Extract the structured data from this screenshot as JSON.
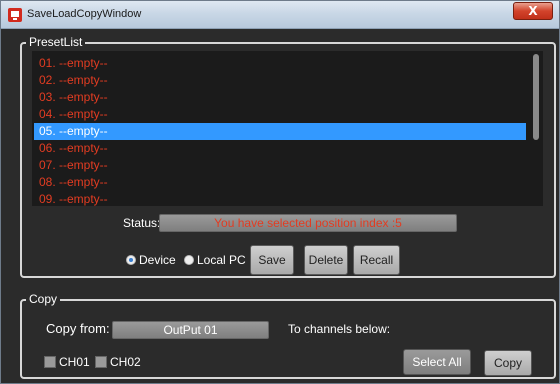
{
  "window": {
    "title": "SaveLoadCopyWindow",
    "close_label": "X"
  },
  "preset_group": {
    "legend": "PresetList",
    "items": [
      {
        "label": "01. --empty--"
      },
      {
        "label": "02. --empty--"
      },
      {
        "label": "03. --empty--"
      },
      {
        "label": "04. --empty--"
      },
      {
        "label": "05. --empty--"
      },
      {
        "label": "06. --empty--"
      },
      {
        "label": "07. --empty--"
      },
      {
        "label": "08. --empty--"
      },
      {
        "label": "09. --empty--"
      }
    ],
    "selected_index": 4,
    "status_label": "Status:",
    "status_text": "You have selected position index :5",
    "radio_device": "Device",
    "radio_local": "Local PC",
    "save_label": "Save",
    "delete_label": "Delete",
    "recall_label": "Recall"
  },
  "copy_group": {
    "legend": "Copy",
    "copy_from_label": "Copy from:",
    "copy_from_value": "OutPut 01",
    "to_channels_label": "To channels below:",
    "ch1_label": "CH01",
    "ch2_label": "CH02",
    "select_all_label": "Select All",
    "copy_label": "Copy"
  },
  "colors": {
    "accent": "#3399ff",
    "empty_text": "#e23c22",
    "background": "#2b2b2b"
  }
}
